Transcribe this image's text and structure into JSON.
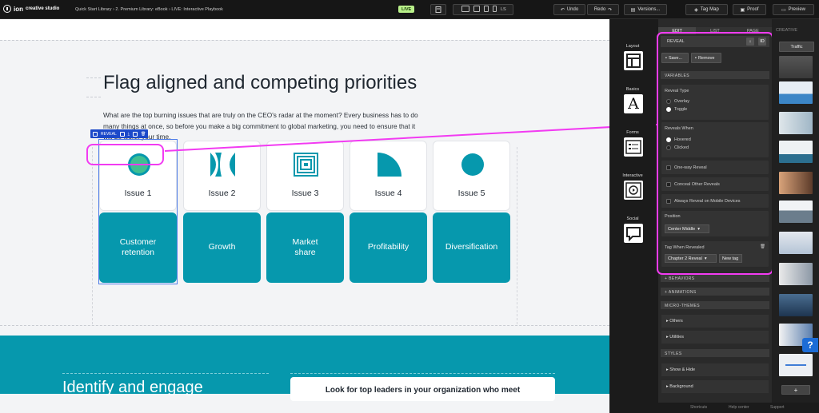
{
  "topbar": {
    "logo_text": "ion",
    "logo_sub": "creative studio",
    "breadcrumb": "Quick Start Library  ›  2. Premium Library: eBook  ›  LIVE: Interactive Playbook",
    "live_badge": "LIVE",
    "device_label": "LS",
    "undo": "Undo",
    "redo": "Redo",
    "versions": "Versions...",
    "tag_map": "Tag Map",
    "proof": "Proof",
    "preview": "Preview"
  },
  "page": {
    "title": "Flag aligned and competing priorities",
    "description": "What are the top burning issues that are truly on the CEO's radar at the moment? Every business has to do many things at once, so before you make a big commitment to global marketing, you need to ensure that it will be worth your time.",
    "toolbar_label": "REVEAL",
    "issues": [
      {
        "label": "Issue 1",
        "tile": "Customer retention"
      },
      {
        "label": "Issue 2",
        "tile": "Growth"
      },
      {
        "label": "Issue 3",
        "tile": "Market share"
      },
      {
        "label": "Issue 4",
        "tile": "Profitability"
      },
      {
        "label": "Issue 5",
        "tile": "Diversification"
      }
    ],
    "band_heading": "Identify and engage",
    "band_card": "Look for top leaders in your organization who meet"
  },
  "icon_sidebar": {
    "items": [
      "Layout",
      "Basics",
      "Forms",
      "Interactive",
      "Social"
    ]
  },
  "panel": {
    "tabs": [
      "EDIT",
      "LIST",
      "PAGE"
    ],
    "creative_tab": "CREATIVE",
    "creative_filter": "Traffic",
    "header": "REVEAL",
    "id_badge": "ID",
    "save": "Save...",
    "remove": "Remove",
    "variables": "VARIABLES",
    "reveal_type_label": "Reveal Type",
    "reveal_type_options": [
      "Overlay",
      "Toggle"
    ],
    "reveal_type_selected": "Toggle",
    "reveals_when_label": "Reveals When",
    "reveals_when_options": [
      "Hovered",
      "Clicked"
    ],
    "reveals_when_selected": "Hovered",
    "checkboxes": [
      "One-way Reveal",
      "Conceal Other Reveals",
      "Always Reveal on Mobile Devices"
    ],
    "position_label": "Position",
    "position_value": "Center Middle",
    "tag_label": "Tag When Revealed",
    "tag_value": "Chapter 2 Reveal",
    "new_tag": "New tag",
    "behaviors": "+ BEHAVIORS",
    "animations": "+ ANIMATIONS",
    "micro_themes": "MICRO-THEMES",
    "others": "Others",
    "utilities": "Utilities",
    "styles": "STYLES",
    "show_hide": "Show & Hide",
    "background": "Background"
  },
  "statusbar": {
    "shortcuts": "Shortcuts",
    "help_center": "Help center",
    "support": "Support"
  },
  "colors": {
    "accent_teal": "#0698ad",
    "highlight_magenta": "#f23bf2",
    "selection_blue": "#1c49c9",
    "live_green": "#b9f08a"
  }
}
